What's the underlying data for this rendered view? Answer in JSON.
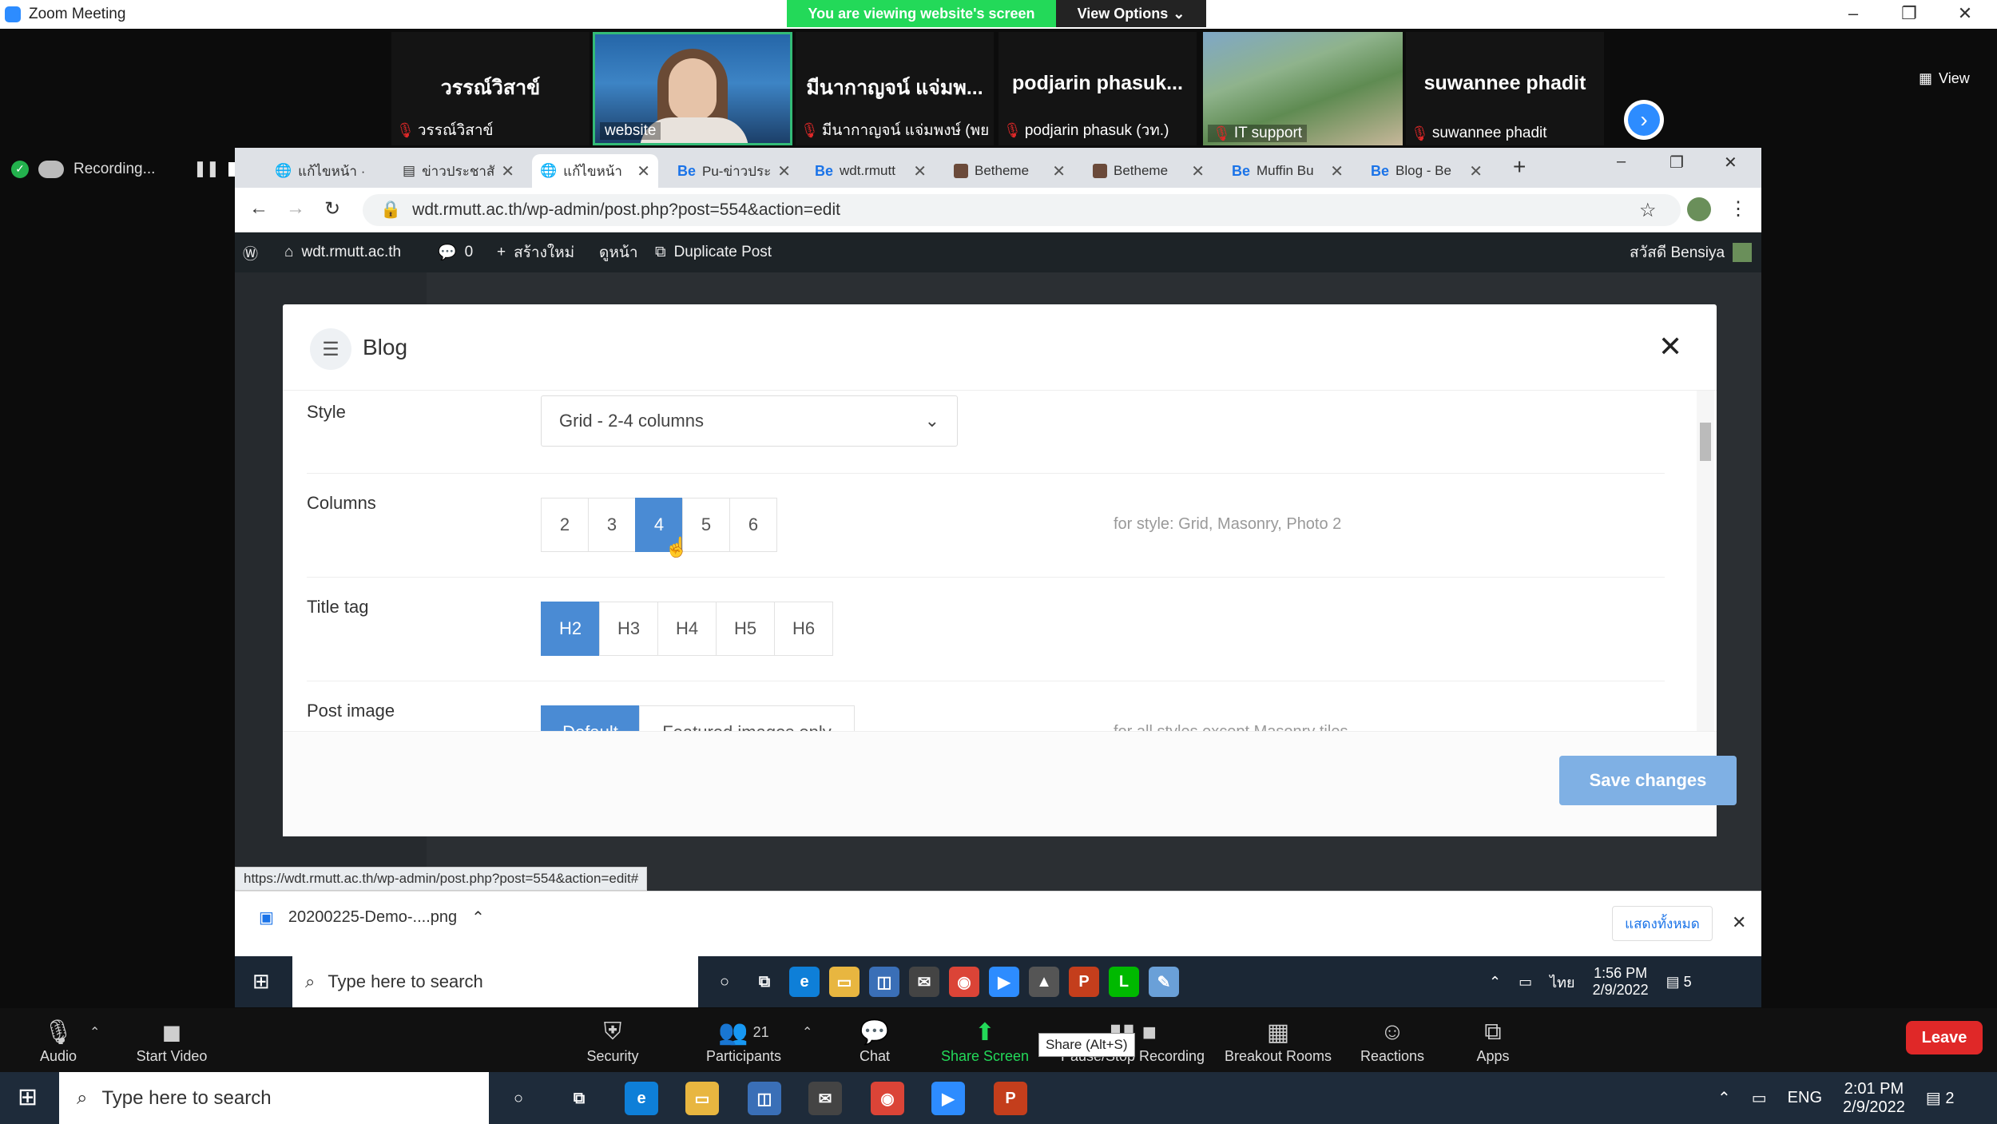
{
  "zoom": {
    "window_title": "Zoom Meeting",
    "viewing_banner": "You are viewing website's screen",
    "view_options": "View Options",
    "view_label": "View",
    "recording_label": "Recording...",
    "participants": [
      {
        "display": "วรรณ์วิสาข์",
        "caption": "วรรณ์วิสาข์"
      },
      {
        "display": "",
        "caption": "website"
      },
      {
        "display": "มีนากาญจน์ แจ่มพ...",
        "caption": "มีนากาญจน์ แจ่มพงษ์ (พย..."
      },
      {
        "display": "podjarin  phasuk...",
        "caption": "podjarin phasuk (วท.)"
      },
      {
        "display": "",
        "caption": "IT support"
      },
      {
        "display": "suwannee phadit",
        "caption": "suwannee phadit"
      }
    ],
    "toolbar": {
      "audio": "Audio",
      "start_video": "Start Video",
      "security": "Security",
      "participants": "Participants",
      "participants_count": "21",
      "chat": "Chat",
      "share_screen": "Share Screen",
      "share_tooltip": "Share (Alt+S)",
      "pause_stop_recording": "Pause/Stop Recording",
      "breakout_rooms": "Breakout Rooms",
      "reactions": "Reactions",
      "apps": "Apps",
      "leave": "Leave"
    }
  },
  "browser": {
    "tabs": [
      {
        "label": "แก้ไขหน้า ·",
        "icon": "globe-icon"
      },
      {
        "label": "ข่าวประชาสั",
        "icon": "doc-icon"
      },
      {
        "label": "แก้ไขหน้า",
        "icon": "globe-icon"
      },
      {
        "label": "Pu-ข่าวประ",
        "icon": "Be"
      },
      {
        "label": "wdt.rmutt",
        "icon": "Be"
      },
      {
        "label": "Betheme",
        "icon": "theme-icon"
      },
      {
        "label": "Betheme",
        "icon": "theme-icon"
      },
      {
        "label": "Muffin Bu",
        "icon": "Be"
      },
      {
        "label": "Blog - Be",
        "icon": "Be"
      }
    ],
    "url": "wdt.rmutt.ac.th/wp-admin/post.php?post=554&action=edit",
    "status_url": "https://wdt.rmutt.ac.th/wp-admin/post.php?post=554&action=edit#",
    "download_file": "20200225-Demo-....png",
    "download_show_all": "แสดงทั้งหมด"
  },
  "wpadmin": {
    "site": "wdt.rmutt.ac.th",
    "comments": "0",
    "new": "สร้างใหม่",
    "view": "ดูหน้า",
    "duplicate": "Duplicate Post",
    "greeting": "สวัสดี Bensiya"
  },
  "modal": {
    "title": "Blog",
    "style_label": "Style",
    "style_value": "Grid - 2-4 columns",
    "columns_label": "Columns",
    "columns_options": [
      "2",
      "3",
      "4",
      "5",
      "6"
    ],
    "columns_selected": "4",
    "columns_hint": "for style: Grid, Masonry, Photo 2",
    "title_tag_label": "Title tag",
    "title_tag_options": [
      "H2",
      "H3",
      "H4",
      "H5",
      "H6"
    ],
    "title_tag_selected": "H2",
    "post_image_label": "Post image",
    "post_image_options": [
      "Default",
      "Featured images only"
    ],
    "post_image_hint": "for all styles except Masonry tiles",
    "save": "Save changes"
  },
  "inner_taskbar": {
    "search_placeholder": "Type here to search",
    "lang": "ไทย",
    "time": "1:56 PM",
    "date": "2/9/2022",
    "notifications": "5"
  },
  "taskbar": {
    "search_placeholder": "Type here to search",
    "lang": "ENG",
    "time": "2:01 PM",
    "date": "2/9/2022",
    "notifications": "2"
  },
  "colors": {
    "zoom_blue": "#2d8cff",
    "zoom_green": "#23d959",
    "selected_button": "#4a8bd4",
    "save_button": "#7fb0e4",
    "leave_red": "#e02828"
  }
}
